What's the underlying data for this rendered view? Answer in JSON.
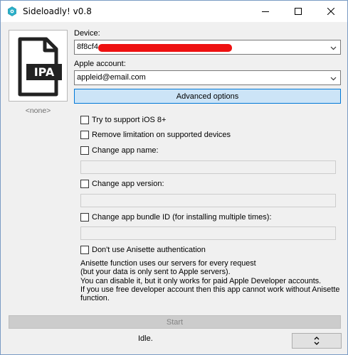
{
  "window": {
    "title": "Sideloadly! v0.8",
    "min_icon": "minimize-icon",
    "max_icon": "maximize-icon",
    "close_icon": "close-icon"
  },
  "file": {
    "badge_text": "IPA",
    "selected_name": "<none>"
  },
  "device": {
    "label": "Device:",
    "value_visible": "8f8cf4"
  },
  "account": {
    "label": "Apple account:",
    "value": "appleid@email.com"
  },
  "advanced_button": "Advanced options",
  "options": {
    "ios8": "Try to support iOS 8+",
    "remove_limitation": "Remove limitation on supported devices",
    "change_name": "Change app name:",
    "change_version": "Change app version:",
    "change_bundle": "Change app bundle ID (for installing multiple times):",
    "no_anisette": "Don't use Anisette authentication"
  },
  "info_lines": [
    "Anisette function uses our servers for every request",
    "(but your data is only sent to Apple servers).",
    "You can disable it, but it only works for paid Apple Developer accounts.",
    "If you use free developer account then this app cannot work without Anisette",
    "function."
  ],
  "start_button": "Start",
  "status": "Idle.",
  "expand_icon": "expand-collapse-icon",
  "colors": {
    "accent_border": "#0078d7",
    "accent_fill": "#cce4f7",
    "redaction": "#ee1111"
  }
}
